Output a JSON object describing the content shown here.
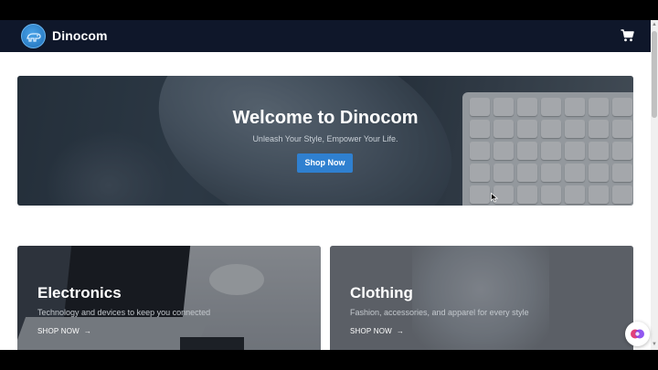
{
  "navbar": {
    "brand": "Dinocom",
    "logo_icon": "dinosaur-logo-icon",
    "cart_icon": "shopping-cart-icon"
  },
  "hero": {
    "title": "Welcome to Dinocom",
    "subtitle": "Unleash Your Style, Empower Your Life.",
    "cta_label": "Shop Now",
    "cta_color": "#2f80d0"
  },
  "categories": [
    {
      "title": "Electronics",
      "description": "Technology and devices to keep you connected",
      "link_label": "SHOP NOW",
      "arrow": "→"
    },
    {
      "title": "Clothing",
      "description": "Fashion, accessories, and apparel for every style",
      "link_label": "SHOP NOW",
      "arrow": "→"
    }
  ],
  "colors": {
    "navbar_bg": "#0f172a",
    "accent": "#2f80d0"
  },
  "chat_icon": "chat-assistant-icon"
}
